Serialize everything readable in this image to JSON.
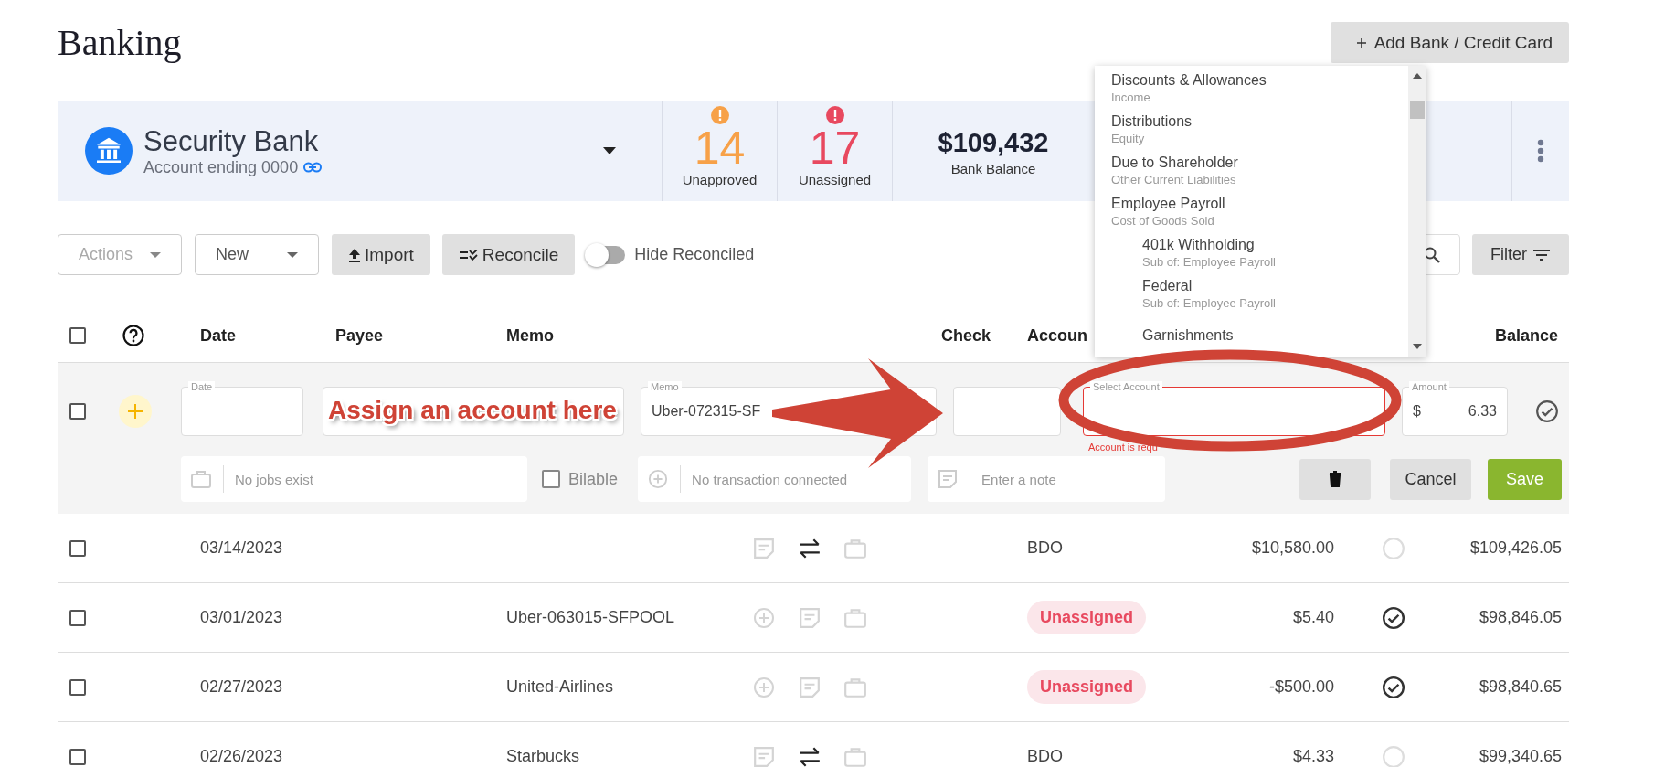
{
  "page_title": "Banking",
  "add_account_button": {
    "label": "Add Bank / Credit Card"
  },
  "account": {
    "name": "Security Bank",
    "subtitle": "Account ending 0000"
  },
  "stats": [
    {
      "kind": "alert",
      "value": "14",
      "label": "Unapproved",
      "color": "#f7a148"
    },
    {
      "kind": "alert",
      "value": "17",
      "label": "Unassigned",
      "color": "#e8495f"
    },
    {
      "kind": "balance",
      "value": "$109,432",
      "label": "Bank Balance"
    }
  ],
  "toolbar": {
    "actions": {
      "label": "Actions",
      "disabled": true
    },
    "new_menu": {
      "label": "New",
      "disabled": false
    },
    "buttons": [
      {
        "kind": "import",
        "label": "Import"
      },
      {
        "kind": "reconcile",
        "label": "Reconcile"
      }
    ],
    "toggle": {
      "label": "Hide Reconciled",
      "on": false
    },
    "filter": {
      "label": "Filter"
    }
  },
  "select_all": {
    "checked": false
  },
  "columns": {
    "date": "Date",
    "payee": "Payee",
    "memo": "Memo",
    "check": "Check",
    "account": "Accoun",
    "balance": "Balance"
  },
  "edit_row": {
    "checked": false,
    "date": {
      "label": "Date"
    },
    "memo": {
      "label": "Memo",
      "value": "Uber-072315-SF"
    },
    "account": {
      "label": "Select Account",
      "error": "Account is requ"
    },
    "amount": {
      "label": "Amount",
      "currency": "$",
      "value": "6.33"
    },
    "job": {
      "placeholder": "No jobs exist"
    },
    "billable": {
      "label": "Bilable",
      "checked": false
    },
    "transaction": {
      "placeholder": "No transaction connected"
    },
    "note": {
      "placeholder": "Enter a note"
    },
    "cancel": "Cancel",
    "save": "Save"
  },
  "rows": [
    {
      "checked": false,
      "date": "03/14/2023",
      "icons": [
        {
          "kind": "note"
        },
        {
          "kind": "transfer"
        },
        {
          "kind": "job"
        }
      ],
      "account": {
        "kind": "plain",
        "text": "BDO"
      },
      "amount": "$10,580.00",
      "approved": false,
      "balance": "$109,426.05"
    },
    {
      "checked": false,
      "date": "03/01/2023",
      "memo": "Uber-063015-SFPOOL",
      "icons": [
        {
          "kind": "add"
        },
        {
          "kind": "note"
        },
        {
          "kind": "job"
        }
      ],
      "account": {
        "kind": "badge",
        "text": "Unassigned"
      },
      "amount": "$5.40",
      "approved": true,
      "balance": "$98,846.05"
    },
    {
      "checked": false,
      "date": "02/27/2023",
      "memo": "United-Airlines",
      "icons": [
        {
          "kind": "add"
        },
        {
          "kind": "note"
        },
        {
          "kind": "job"
        }
      ],
      "account": {
        "kind": "badge",
        "text": "Unassigned"
      },
      "amount": "-$500.00",
      "approved": true,
      "balance": "$98,840.65"
    },
    {
      "checked": false,
      "date": "02/26/2023",
      "memo": "Starbucks",
      "icons": [
        {
          "kind": "note"
        },
        {
          "kind": "transfer"
        },
        {
          "kind": "job"
        }
      ],
      "account": {
        "kind": "plain",
        "text": "BDO"
      },
      "amount": "$4.33",
      "approved": false,
      "balance": "$99,340.65"
    }
  ],
  "account_menu": {
    "items": [
      {
        "name": "Discounts & Allowances",
        "type": "Income"
      },
      {
        "name": "Distributions",
        "type": "Equity"
      },
      {
        "name": "Due to Shareholder",
        "type": "Other Current Liabilities"
      },
      {
        "name": "Employee Payroll",
        "type": "Cost of Goods Sold",
        "children": [
          {
            "name": "401k Withholding",
            "type": "Sub of: Employee Payroll"
          },
          {
            "name": "Federal",
            "type": "Sub of: Employee Payroll"
          },
          {
            "name": "Garnishments"
          }
        ]
      }
    ]
  },
  "annotation": {
    "text": "Assign an account here"
  }
}
